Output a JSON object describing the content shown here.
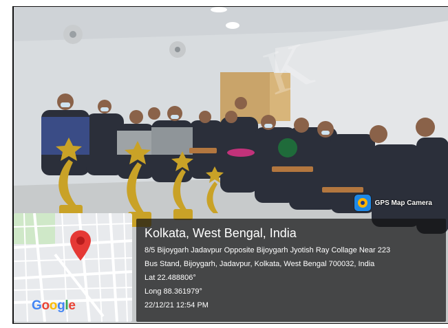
{
  "app": {
    "name": "GPS Map Camera",
    "icon": "gps-map-camera-app-icon"
  },
  "location": {
    "title": "Kolkata, West Bengal, India",
    "address_line1": "8/5 Bijoygarh Jadavpur Opposite Bijoygarh Jyotish Ray Collage Near 223",
    "address_line2": "Bus Stand, Bijoygarh, Jadavpur, Kolkata, West Bengal 700032, India",
    "lat": "Lat 22.488806°",
    "long": "Long 88.361979°",
    "datetime": "22/12/21 12:54 PM"
  },
  "map": {
    "logo_letters": [
      "G",
      "o",
      "o",
      "g",
      "l",
      "e"
    ],
    "pin_color": "#e53935",
    "pin_icon": "map-pin-icon"
  },
  "colors": {
    "overlay": "#141414",
    "wall": "#dfe3e6",
    "floor": "#cfd2d3",
    "trophy_gold": "#c9a227"
  }
}
